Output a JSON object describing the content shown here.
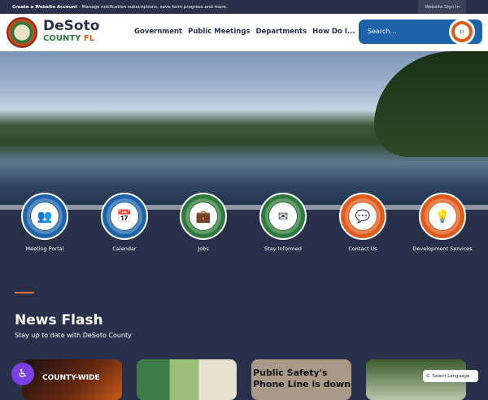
{
  "topbar": {
    "account_link": "Create a Website Account",
    "message": " - Manage notification subscriptions, save form progress and more.",
    "sign_in": "Website Sign In"
  },
  "header": {
    "brand_line1": "DeSoto",
    "brand_county": "COUNTY ",
    "brand_state": "FL",
    "nav": [
      "Government",
      "Public Meetings",
      "Departments",
      "How Do I..."
    ],
    "search_placeholder": "Search..."
  },
  "quick_links": [
    {
      "label": "Meeting Portal",
      "icon": "👥",
      "color": "#1d63aa"
    },
    {
      "label": "Calendar",
      "icon": "📅",
      "color": "#1d63aa"
    },
    {
      "label": "Jobs",
      "icon": "💼",
      "color": "#2f7a3c"
    },
    {
      "label": "Stay Informed",
      "icon": "✉",
      "color": "#2f7a3c"
    },
    {
      "label": "Contact Us",
      "icon": "💬",
      "color": "#e05a1a"
    },
    {
      "label": "Development Services",
      "icon": "💡",
      "color": "#e05a1a"
    }
  ],
  "news": {
    "title": "News Flash",
    "subtitle": "Stay up to date with DeSoto County",
    "cards": [
      "COUNTY-WIDE",
      "",
      "Public Safety's Phone Line is down",
      ""
    ]
  },
  "translate": {
    "label": "Select Language"
  }
}
